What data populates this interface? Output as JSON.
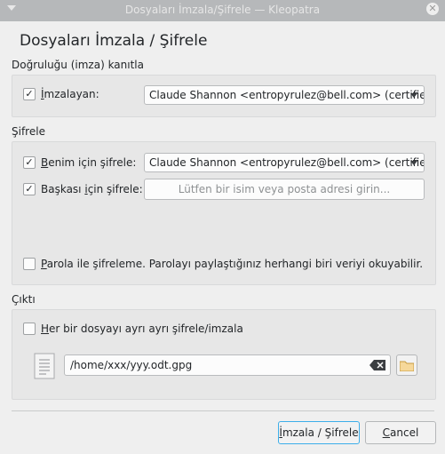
{
  "window": {
    "title": "Dosyaları İmzala/Şifrele — Kleopatra",
    "close_glyph": "✕"
  },
  "heading": "Dosyaları İmzala / Şifrele",
  "sign": {
    "section_label": "Doğruluğu (imza) kanıtla",
    "signer": {
      "checked": true,
      "label_pre": "",
      "label_underlined": "İ",
      "label_post": "mzalayan:",
      "value": "Claude Shannon <entropyrulez@bell.com> (certified"
    }
  },
  "encrypt": {
    "section_label": "Şifrele",
    "for_me": {
      "checked": true,
      "label_pre": "",
      "label_underlined": "B",
      "label_post": "enim için şifrele:",
      "value": "Claude Shannon <entropyrulez@bell.com> (certified"
    },
    "for_others": {
      "checked": true,
      "label_pre": "Başkası ",
      "label_underlined": "i",
      "label_post": "çin şifrele:",
      "placeholder": "Lütfen bir isim veya posta adresi girin..."
    },
    "password": {
      "checked": false,
      "label_pre": "",
      "label_underlined": "P",
      "label_post": "arola ile şifreleme. Parolayı paylaştığınız herhangi biri veriyi okuyabilir."
    }
  },
  "output": {
    "section_label": "Çıktı",
    "separate": {
      "checked": false,
      "label_pre": "",
      "label_underlined": "H",
      "label_post": "er bir dosyayı ayrı ayrı şifrele/imzala"
    },
    "path": "/home/xxx/yyy.odt.gpg"
  },
  "buttons": {
    "sign_encrypt_pre": "",
    "sign_encrypt_underlined": "İ",
    "sign_encrypt_post": "mzala / Şifrele",
    "cancel_pre": "",
    "cancel_underlined": "C",
    "cancel_post": "ancel"
  },
  "colors": {
    "accent": "#3daee9",
    "titlebar": "#b6b8ba",
    "window_bg": "#efefef"
  },
  "icons": {
    "menu": "chevron-down-icon",
    "close": "close-icon",
    "file": "file-icon",
    "clear": "clear-text-icon",
    "folder": "folder-icon"
  }
}
